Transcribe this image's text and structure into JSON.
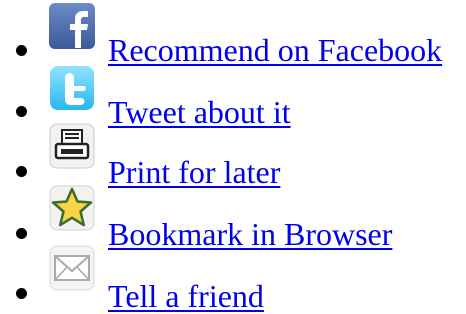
{
  "share_links": [
    {
      "label": "Recommend on Facebook",
      "icon": "facebook-icon"
    },
    {
      "label": "Tweet about it",
      "icon": "twitter-icon"
    },
    {
      "label": "Print for later",
      "icon": "printer-icon"
    },
    {
      "label": "Bookmark in Browser",
      "icon": "star-icon"
    },
    {
      "label": "Tell a friend",
      "icon": "envelope-icon"
    }
  ],
  "colors": {
    "link": "#0000ee",
    "facebook_blue": "#3b5998",
    "twitter_blue": "#33ccff",
    "star_yellow": "#f7d547"
  }
}
